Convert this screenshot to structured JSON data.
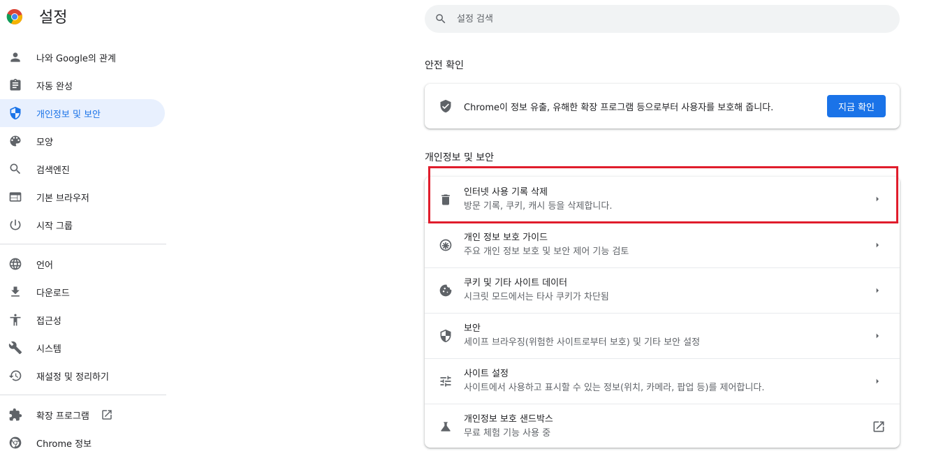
{
  "header": {
    "title": "설정"
  },
  "search": {
    "placeholder": "설정 검색"
  },
  "sidebar": {
    "items": [
      {
        "label": "나와 Google의 관계",
        "icon": "person-icon"
      },
      {
        "label": "자동 완성",
        "icon": "clipboard-icon"
      },
      {
        "label": "개인정보 및 보안",
        "icon": "shield-icon",
        "active": true
      },
      {
        "label": "모양",
        "icon": "palette-icon"
      },
      {
        "label": "검색엔진",
        "icon": "search-icon"
      },
      {
        "label": "기본 브라우저",
        "icon": "browser-icon"
      },
      {
        "label": "시작 그룹",
        "icon": "power-icon"
      }
    ],
    "items2": [
      {
        "label": "언어",
        "icon": "globe-icon"
      },
      {
        "label": "다운로드",
        "icon": "download-icon"
      },
      {
        "label": "접근성",
        "icon": "accessibility-icon"
      },
      {
        "label": "시스템",
        "icon": "wrench-icon"
      },
      {
        "label": "재설정 및 정리하기",
        "icon": "history-icon"
      }
    ],
    "items3": [
      {
        "label": "확장 프로그램",
        "icon": "puzzle-icon"
      },
      {
        "label": "Chrome 정보",
        "icon": "chrome-icon"
      }
    ]
  },
  "safety": {
    "section_title": "안전 확인",
    "text": "Chrome이 정보 유출, 유해한 확장 프로그램 등으로부터 사용자를 보호해 줍니다.",
    "button": "지금 확인"
  },
  "privacy": {
    "section_title": "개인정보 및 보안",
    "rows": [
      {
        "title": "인터넷 사용 기록 삭제",
        "subtitle": "방문 기록, 쿠키, 캐시 등을 삭제합니다.",
        "icon": "trash-icon",
        "highlighted": true
      },
      {
        "title": "개인 정보 보호 가이드",
        "subtitle": "주요 개인 정보 보호 및 보안 제어 기능 검토",
        "icon": "compass-icon"
      },
      {
        "title": "쿠키 및 기타 사이트 데이터",
        "subtitle": "시크릿 모드에서는 타사 쿠키가 차단됨",
        "icon": "cookie-icon"
      },
      {
        "title": "보안",
        "subtitle": "세이프 브라우징(위험한 사이트로부터 보호) 및 기타 보안 설정",
        "icon": "security-shield-icon"
      },
      {
        "title": "사이트 설정",
        "subtitle": "사이트에서 사용하고 표시할 수 있는 정보(위치, 카메라, 팝업 등)를 제어합니다.",
        "icon": "tune-icon"
      },
      {
        "title": "개인정보 보호 샌드박스",
        "subtitle": "무료 체험 기능 사용 중",
        "icon": "flask-icon",
        "external": true
      }
    ]
  },
  "colors": {
    "accent": "#1a73e8",
    "highlight": "#e01d2c",
    "active_bg": "#e8f0fe"
  }
}
